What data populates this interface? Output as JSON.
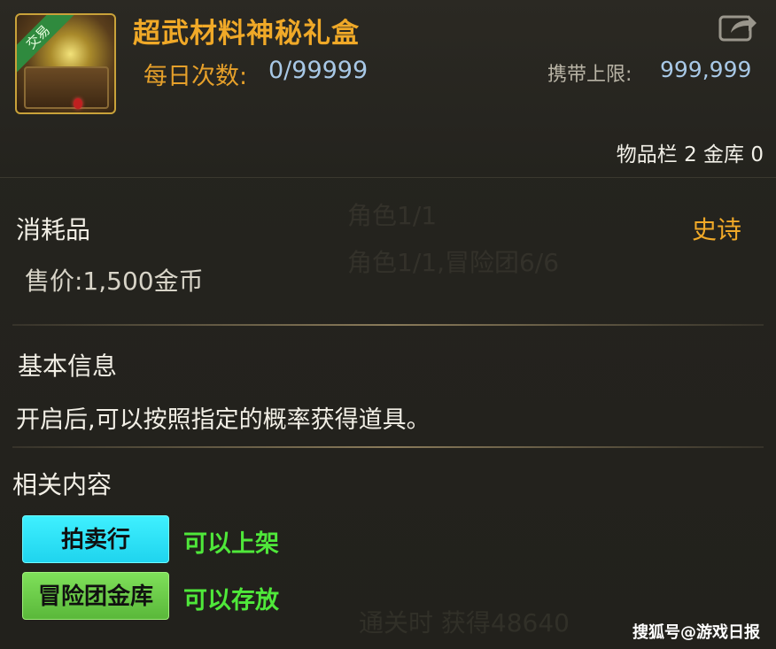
{
  "item": {
    "icon": "mystery-gift-box-icon",
    "trade_tag": "交易",
    "name": "超武材料神秘礼盒",
    "daily_label": "每日次数:",
    "daily_value": "0/99999",
    "carry_label": "携带上限:",
    "carry_value": "999,999",
    "storage": "物品栏 2 金库 0",
    "category": "消耗品",
    "rarity": "史诗",
    "price": "售价:1,500金币"
  },
  "basic_info": {
    "title": "基本信息",
    "description": "开启后,可以按照指定的概率获得道具。"
  },
  "related": {
    "title": "相关内容",
    "items": [
      {
        "button": "拍卖行",
        "status": "可以上架"
      },
      {
        "button": "冒险团金库",
        "status": "可以存放"
      }
    ]
  },
  "background_text": {
    "line1": "角色1/1",
    "line2": "角色1/1,冒险团6/6",
    "line3": "通关时 获得48640"
  },
  "watermark": "搜狐号@游戏日报",
  "colors": {
    "item_name": "#f0a928",
    "rarity_epic": "#f0a928",
    "value_blue": "#a8c8e6",
    "auction_button": "#3ff0ff",
    "vault_button": "#7fe05a",
    "status_green": "#4fe83a"
  }
}
